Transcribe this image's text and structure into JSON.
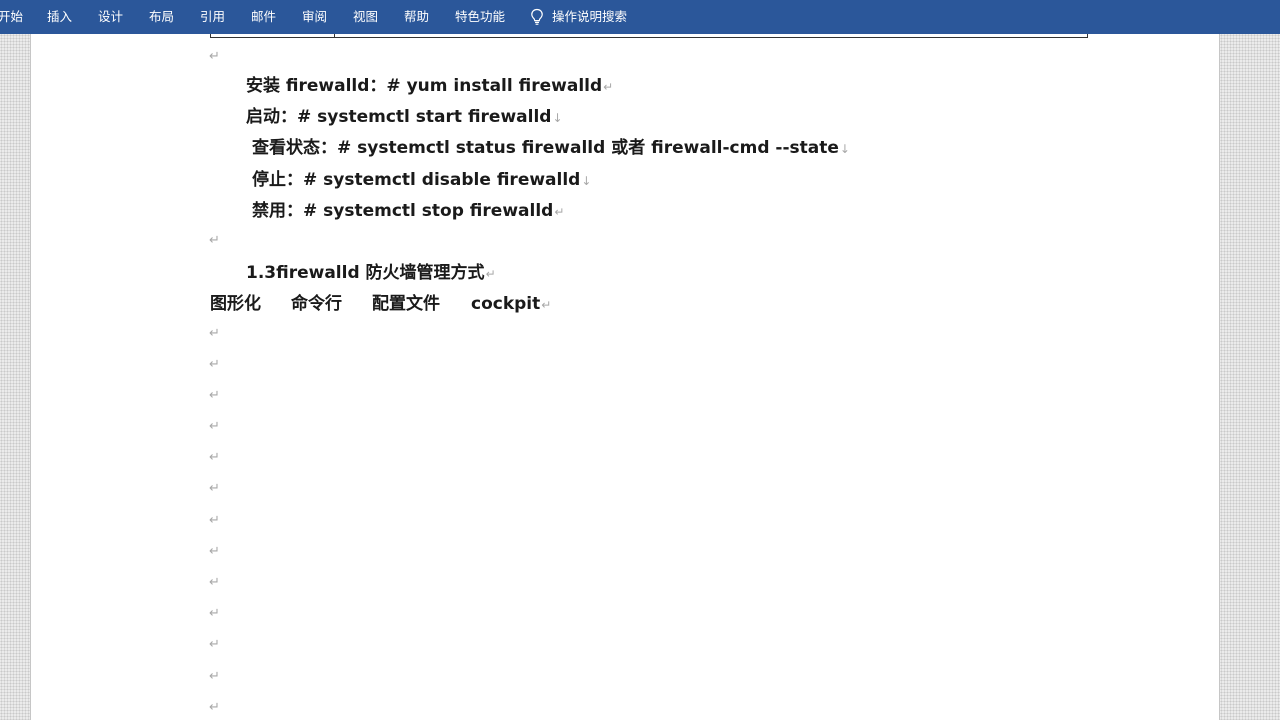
{
  "ribbon": {
    "tabs": [
      "开始",
      "插入",
      "设计",
      "布局",
      "引用",
      "邮件",
      "审阅",
      "视图",
      "帮助",
      "特色功能"
    ],
    "search_label": "操作说明搜索",
    "search_icon": "lightbulb-icon",
    "background_color": "#2b579a"
  },
  "document": {
    "paragraph_mark": "↵",
    "line_break_mark": "↓",
    "commands": [
      {
        "text": "安装 firewalld：# yum install firewalld",
        "end": "↵"
      },
      {
        "text": "启动：# systemctl start firewalld",
        "end": "↓"
      },
      {
        "text": "查看状态：# systemctl status firewalld  或者  firewall-cmd --state",
        "end": "↓"
      },
      {
        "text": "停止：# systemctl disable firewalld",
        "end": "↓"
      },
      {
        "text": "禁用：# systemctl stop firewalld",
        "end": "↵"
      }
    ],
    "heading": {
      "text": "1.3firewalld 防火墙管理方式",
      "end": "↵"
    },
    "modes": [
      "图形化",
      "命令行",
      "配置文件",
      "cockpit"
    ],
    "modes_end": "↵"
  }
}
